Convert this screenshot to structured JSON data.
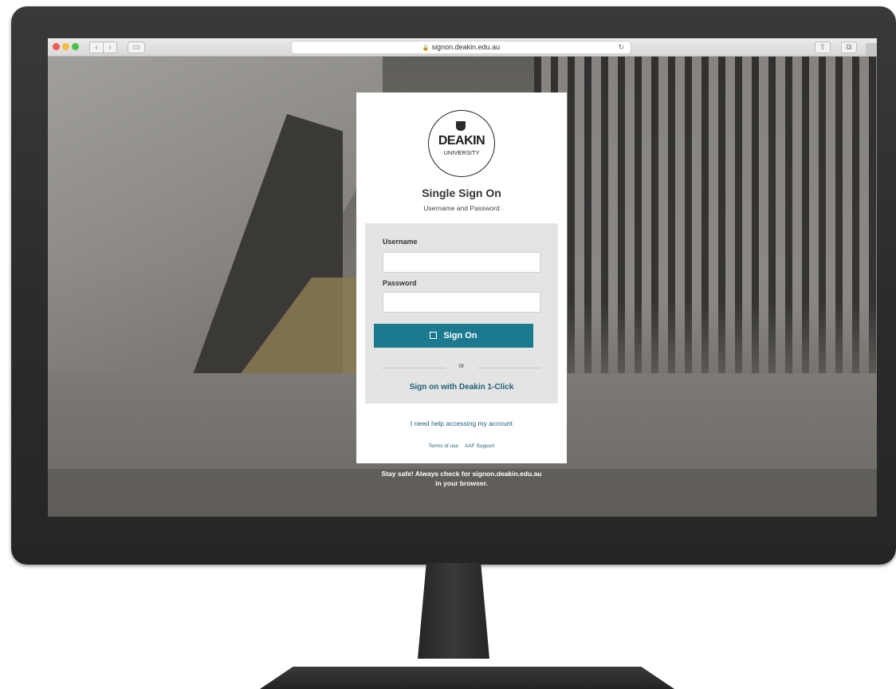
{
  "browser": {
    "url": "signon.deakin.edu.au",
    "back_icon": "chevron-left-icon",
    "forward_icon": "chevron-right-icon"
  },
  "logo": {
    "name": "DEAKIN",
    "subtitle": "UNIVERSITY"
  },
  "login": {
    "title": "Single Sign On",
    "subtitle": "Username and Password",
    "username_label": "Username",
    "username_value": "",
    "password_label": "Password",
    "password_value": "",
    "sign_on_label": "Sign On",
    "or_text": "or",
    "one_click_label": "Sign on with Deakin 1-Click",
    "help_link": "I need help accessing my account",
    "terms_link": "Terms of use",
    "support_link": "AAF Support"
  },
  "notice": {
    "line1": "Stay safe! Always check for signon.deakin.edu.au",
    "line2": "in your browser."
  },
  "colors": {
    "accent": "#1b7a8f",
    "link": "#1e5f78"
  }
}
